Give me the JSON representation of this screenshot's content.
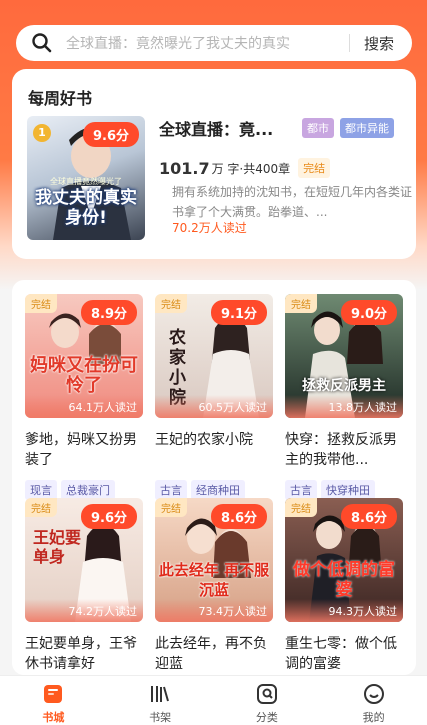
{
  "search": {
    "placeholder": "全球直播：竟然曝光了我丈夫的真实",
    "button": "搜索"
  },
  "weekly": {
    "section_title": "每周好书",
    "book": {
      "rank": "1",
      "score": "9.6分",
      "cover_title": "我丈夫的真实身份!",
      "cover_sub": "全球直播竟然曝光了",
      "name": "全球直播：竟...",
      "tags": [
        "都市",
        "都市异能"
      ],
      "word_count": "101.7",
      "word_unit": "万 字·共400章",
      "status": "完结",
      "desc": "拥有系统加持的沈知书，在短短几年内各类证书拿了个大满贯。跆拳道、...",
      "reads": "70.2万人读过"
    }
  },
  "books": [
    {
      "status": "完结",
      "score": "8.9分",
      "cover_title": "妈咪又在扮可怜了",
      "reads": "64.1万人读过",
      "title": "爹地，妈咪又扮男装了",
      "tags": [
        "现言",
        "总裁豪门"
      ],
      "colors": {
        "top": "#f7c9c0",
        "bottom": "#f08a7e",
        "text": "#e23a2a"
      }
    },
    {
      "status": "完结",
      "score": "9.1分",
      "cover_title": "农家小院",
      "reads": "60.5万人读过",
      "title": "王妃的农家小院",
      "tags": [
        "古言",
        "经商种田"
      ],
      "colors": {
        "top": "#f2ece6",
        "bottom": "#d9c8c0",
        "text": "#3a2a2a"
      }
    },
    {
      "status": "完结",
      "score": "9.0分",
      "cover_title": "拯救反派男主",
      "reads": "13.8万人读过",
      "title": "快穿：拯救反派男主的我带他...",
      "tags": [
        "古言",
        "快穿种田"
      ],
      "colors": {
        "top": "#4f6a56",
        "bottom": "#1e2a24",
        "text": "#ffffff"
      }
    },
    {
      "status": "完结",
      "score": "9.6分",
      "cover_title": "王妃要单身",
      "reads": "74.2万人读过",
      "title": "王妃要单身，王爷休书请拿好",
      "tags": [
        "古言",
        "宫斗"
      ],
      "colors": {
        "top": "#f7ebe4",
        "bottom": "#e4cfc4",
        "text": "#c0271f"
      }
    },
    {
      "status": "完结",
      "score": "8.6分",
      "cover_title": "此去经年 再不服沉蓝",
      "reads": "73.4万人读过",
      "title": "此去经年，再不负迎蓝",
      "tags": [
        "现言",
        "虐恋"
      ],
      "colors": {
        "top": "#f6d9c6",
        "bottom": "#d6a085",
        "text": "#e02a1a"
      }
    },
    {
      "status": "完结",
      "score": "8.6分",
      "cover_title": "做个低调的富婆",
      "reads": "94.3万人读过",
      "title": "重生七零：做个低调的富婆",
      "tags": [
        "现言",
        "年代"
      ],
      "colors": {
        "top": "#8a5e52",
        "bottom": "#3a2522",
        "text": "#ff3a2a"
      }
    }
  ],
  "tabs": [
    {
      "label": "书城",
      "icon": "bookstore-icon",
      "active": true
    },
    {
      "label": "书架",
      "icon": "bookshelf-icon",
      "active": false
    },
    {
      "label": "分类",
      "icon": "category-icon",
      "active": false
    },
    {
      "label": "我的",
      "icon": "profile-icon",
      "active": false
    }
  ],
  "theme": {
    "accent": "#ff5a1f",
    "header": "#ff6a3d"
  }
}
